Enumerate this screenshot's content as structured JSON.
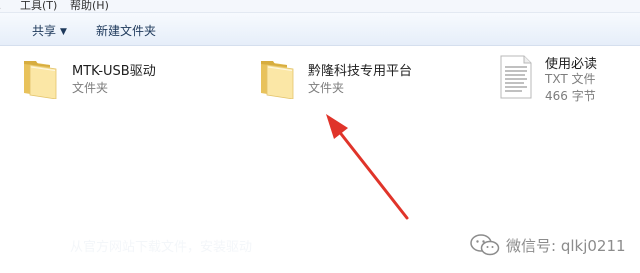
{
  "menubar": {
    "edge": "(",
    "tools": "工具(T)",
    "help": "帮助(H)"
  },
  "toolbar": {
    "share_label": "共享",
    "new_folder_label": "新建文件夹",
    "left_edge": "‹"
  },
  "files": [
    {
      "name": "MTK-USB驱动",
      "type": "文件夹",
      "icon": "folder-icon"
    },
    {
      "name": "黔隆科技专用平台",
      "type": "文件夹",
      "icon": "folder-icon"
    },
    {
      "name": "使用必读",
      "type": "TXT 文件",
      "size": "466 字节",
      "icon": "text-file-icon"
    }
  ],
  "overlay_text": "从官方网站下载文件，安装驱动",
  "watermark": {
    "text": "微信号: qlkj0211",
    "icon": "wechat-logo"
  },
  "colors": {
    "arrow": "#e0342a",
    "folder_light": "#fbe7a6",
    "folder_dark": "#e8c25b",
    "toolbar_text": "#1e395b"
  }
}
